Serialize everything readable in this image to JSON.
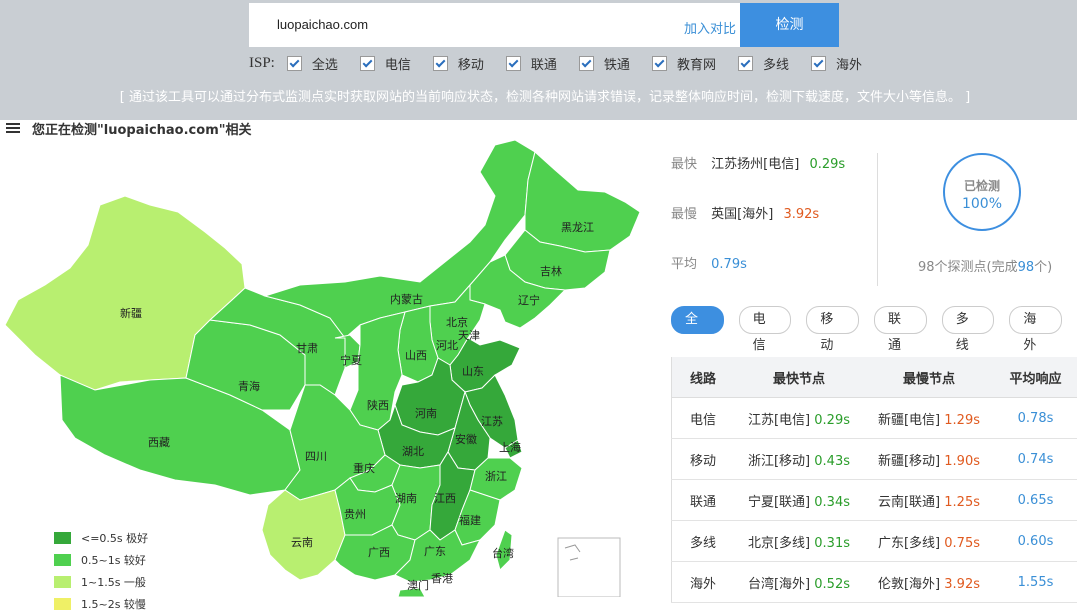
{
  "search": {
    "value": "luopaichao.com",
    "add_compare": "加入对比",
    "detect_button": "检测"
  },
  "isp": {
    "label": "ISP:",
    "options": [
      "全选",
      "电信",
      "移动",
      "联通",
      "铁通",
      "教育网",
      "多线",
      "海外"
    ]
  },
  "notice": "[ 通过该工具可以通过分布式监测点实时获取网站的当前响应状态，检测各种网站请求错误，记录整体响应时间，检测下载速度，文件大小等信息。 ]",
  "section_title": "您正在检测\"luopaichao.com\"相关",
  "map": {
    "provinces": [
      "新疆",
      "西藏",
      "青海",
      "甘肃",
      "内蒙古",
      "宁夏",
      "陕西",
      "山西",
      "河北",
      "北京",
      "天津",
      "辽宁",
      "吉林",
      "黑龙江",
      "山东",
      "河南",
      "江苏",
      "安徽",
      "上海",
      "湖北",
      "四川",
      "重庆",
      "贵州",
      "云南",
      "湖南",
      "江西",
      "浙江",
      "福建",
      "广西",
      "广东",
      "台湾",
      "澳门",
      "香港"
    ],
    "colors": {
      "excellent": "#35a83a",
      "good": "#4fd04f",
      "ok": "#b8ef70",
      "slow": "#eff066"
    }
  },
  "legend": [
    {
      "label": "<=0.5s 极好",
      "color": "#35a83a"
    },
    {
      "label": "0.5~1s 较好",
      "color": "#4fd04f"
    },
    {
      "label": "1~1.5s 一般",
      "color": "#b8ef70"
    },
    {
      "label": "1.5~2s 较慢",
      "color": "#eff066"
    }
  ],
  "stats": {
    "fastest": {
      "label": "最快",
      "node": "江苏扬州[电信]",
      "time": "0.29s"
    },
    "slowest": {
      "label": "最慢",
      "node": "英国[海外]",
      "time": "3.92s"
    },
    "average": {
      "label": "平均",
      "time": "0.79s"
    },
    "progress": {
      "title": "已检测",
      "percent": "100%",
      "percent_value": 100
    },
    "probes_text_pre": "98个探测点(完成",
    "probes_done": "98",
    "probes_text_post": "个)"
  },
  "tabs": [
    "全部",
    "电信",
    "移动",
    "联通",
    "多线",
    "海外"
  ],
  "table": {
    "headers": [
      "线路",
      "最快节点",
      "最慢节点",
      "平均响应"
    ],
    "rows": [
      {
        "line": "电信",
        "fast_node": "江苏[电信]",
        "fast_time": "0.29s",
        "slow_node": "新疆[电信]",
        "slow_time": "1.29s",
        "avg": "0.78s"
      },
      {
        "line": "移动",
        "fast_node": "浙江[移动]",
        "fast_time": "0.43s",
        "slow_node": "新疆[移动]",
        "slow_time": "1.90s",
        "avg": "0.74s"
      },
      {
        "line": "联通",
        "fast_node": "宁夏[联通]",
        "fast_time": "0.34s",
        "slow_node": "云南[联通]",
        "slow_time": "1.25s",
        "avg": "0.65s"
      },
      {
        "line": "多线",
        "fast_node": "北京[多线]",
        "fast_time": "0.31s",
        "slow_node": "广东[多线]",
        "slow_time": "0.75s",
        "avg": "0.60s"
      },
      {
        "line": "海外",
        "fast_node": "台湾[海外]",
        "fast_time": "0.52s",
        "slow_node": "伦敦[海外]",
        "slow_time": "3.92s",
        "avg": "1.55s"
      }
    ]
  }
}
